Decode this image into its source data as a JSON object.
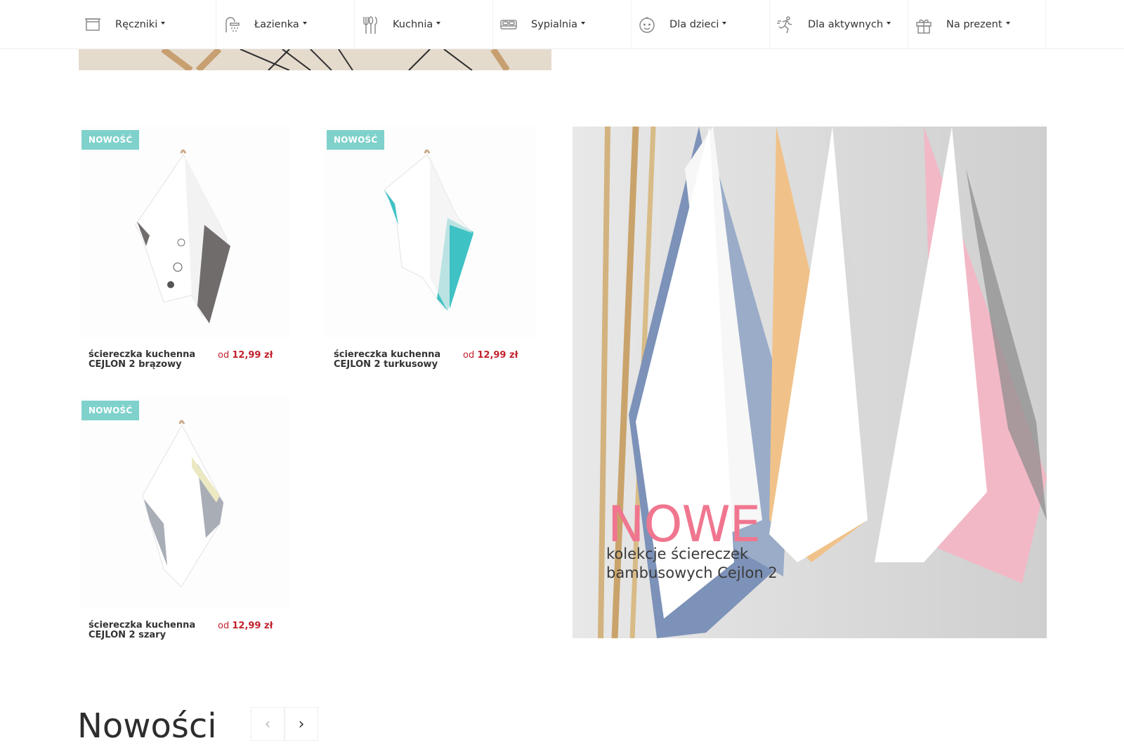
{
  "nav": {
    "items": [
      {
        "label": "Ręczniki",
        "icon": "towel-icon"
      },
      {
        "label": "Łazienka",
        "icon": "shower-icon"
      },
      {
        "label": "Kuchnia",
        "icon": "cutlery-icon"
      },
      {
        "label": "Sypialnia",
        "icon": "bed-icon"
      },
      {
        "label": "Dla dzieci",
        "icon": "baby-icon"
      },
      {
        "label": "Dla aktywnych",
        "icon": "runner-icon"
      },
      {
        "label": "Na prezent",
        "icon": "gift-icon"
      }
    ]
  },
  "products": [
    {
      "badge": "NOWOŚĆ",
      "name": "ściereczka kuchenna CEJLON 2 brązowy",
      "price_prefix": "od",
      "price": "12,99 zł",
      "accent": "#6f6c6b"
    },
    {
      "badge": "NOWOŚĆ",
      "name": "ściereczka kuchenna CEJLON 2 turkusowy",
      "price_prefix": "od",
      "price": "12,99 zł",
      "accent": "#3fc2c4"
    },
    {
      "badge": "NOWOŚĆ",
      "name": "ściereczka kuchenna CEJLON 2 szary",
      "price_prefix": "od",
      "price": "12,99 zł",
      "accent": "#a8adb6"
    }
  ],
  "promo": {
    "title": "NOWE",
    "subtitle": "kolekcje ściereczek bambusowych Cejlon 2"
  },
  "section": {
    "title": "Nowości",
    "prev": "‹",
    "next": "›"
  },
  "colors": {
    "badge": "#7fd1cc",
    "price": "#c2212d",
    "promo_title": "#f0768f"
  }
}
